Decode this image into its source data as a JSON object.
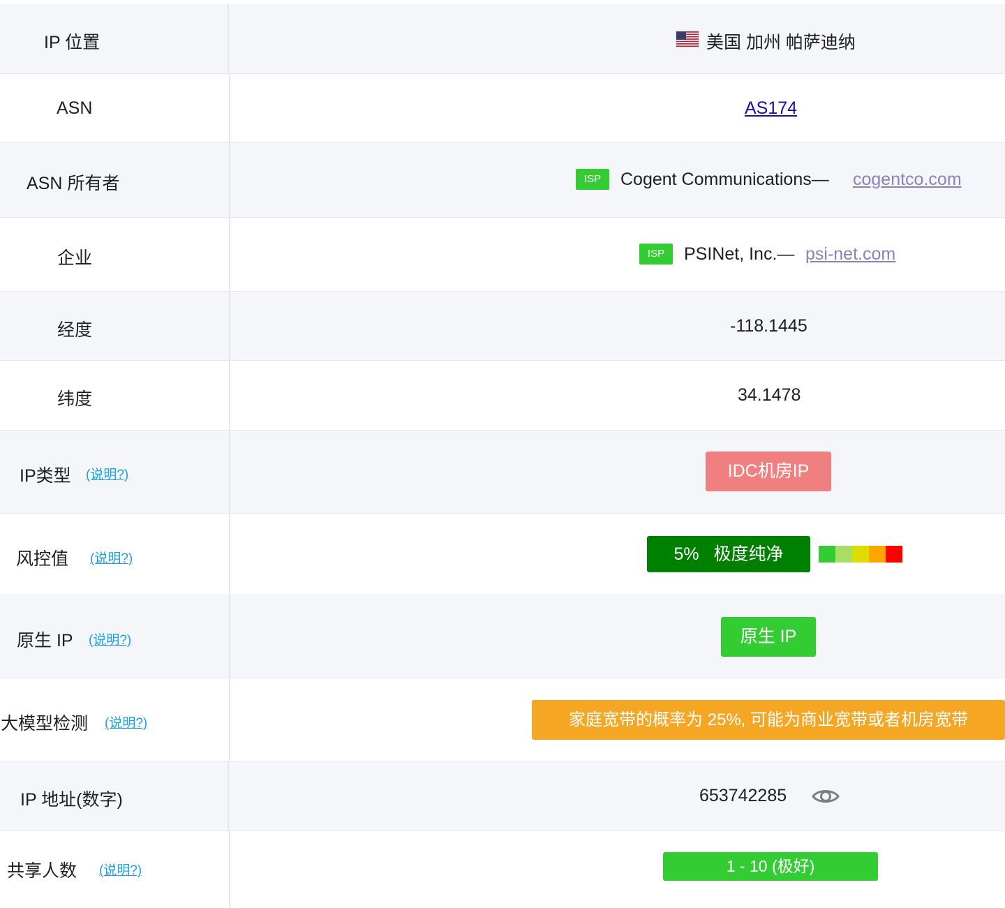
{
  "rows": {
    "location": {
      "label": "IP 位置",
      "value": "美国 加州 帕萨迪纳",
      "flag_icon": "us-flag-icon"
    },
    "asn": {
      "label": "ASN",
      "value": "AS174"
    },
    "asn_owner": {
      "label": "ASN 所有者",
      "badge": "ISP",
      "name": "Cogent Communications—",
      "domain": "cogentco.com"
    },
    "enterprise": {
      "label": "企业",
      "badge": "ISP",
      "name": "PSINet, Inc.—",
      "domain": "psi-net.com"
    },
    "longitude": {
      "label": "经度",
      "value": "-118.1445"
    },
    "latitude": {
      "label": "纬度",
      "value": "34.1478"
    },
    "ip_type": {
      "label": "IP类型",
      "help": "(说明?)",
      "value": "IDC机房IP",
      "color": "#f07f7f"
    },
    "risk": {
      "label": "风控值",
      "help": "(说明?)",
      "percent": "5%",
      "level": "极度纯净",
      "color": "#008000",
      "scale_colors": [
        "#33cc33",
        "#aadd66",
        "#dddd00",
        "#ffa500",
        "#ff0000"
      ]
    },
    "native_ip": {
      "label": "原生 IP",
      "help": "(说明?)",
      "value": "原生 IP",
      "color": "#33cc33"
    },
    "ai_detect": {
      "label": "大模型检测",
      "help": "(说明?)",
      "value": "家庭宽带的概率为 25%, 可能为商业宽带或者机房宽带",
      "color": "#f5a623"
    },
    "ip_numeric": {
      "label": "IP 地址(数字)",
      "value": "653742285",
      "icon": "eye-icon"
    },
    "shared_users": {
      "label": "共享人数",
      "help": "(说明?)",
      "value": "1 - 10 (极好)",
      "color": "#33cc33"
    }
  }
}
